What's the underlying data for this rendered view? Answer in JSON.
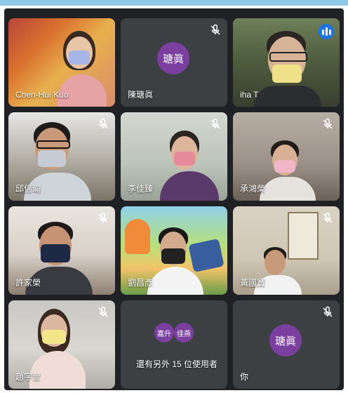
{
  "participants": [
    {
      "name": "Chen-Hui Kuo",
      "muted": false,
      "speaking": false
    },
    {
      "name": "陳瑭眞",
      "muted": true,
      "avatar_text": "瑭眞",
      "speaking": false
    },
    {
      "name": "iha T",
      "muted": false,
      "speaking": true
    },
    {
      "name": "邱信瑜",
      "muted": true
    },
    {
      "name": "李佳臻",
      "muted": true
    },
    {
      "name": "承鴻榮",
      "muted": true
    },
    {
      "name": "許家榮",
      "muted": true
    },
    {
      "name": "劉昌彥",
      "muted": false
    },
    {
      "name": "黃國寶",
      "muted": true
    },
    {
      "name": "趙宇萱",
      "muted": true
    },
    {
      "name": "還有另外 15 位使用者",
      "others_avatars": [
        "嘉升",
        "佳燕"
      ]
    },
    {
      "name": "你",
      "muted": true,
      "avatar_text": "瑭眞"
    }
  ],
  "colors": {
    "background": "#202124",
    "tile": "#3c4043",
    "avatar": "#7b3fa0",
    "active_border": "#8ab4f8",
    "speaking_badge": "#1a73e8",
    "top_strip": "#8ec9ea"
  },
  "icons": {
    "muted": "mic-off-icon",
    "speaking": "audio-level-icon"
  }
}
